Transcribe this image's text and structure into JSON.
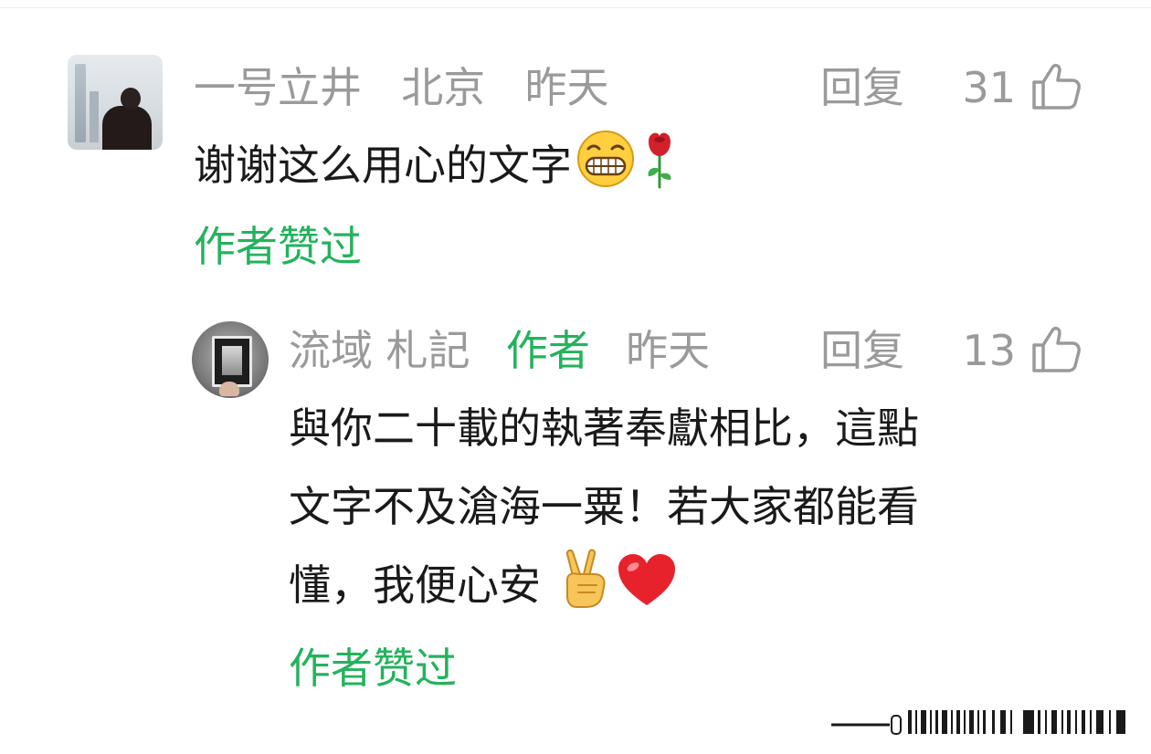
{
  "colors": {
    "meta_gray": "#9a9a9a",
    "text_black": "#1a1a1a",
    "accent_green": "#23b35c"
  },
  "comment": {
    "username": "一号立井",
    "location": "北京",
    "time": "昨天",
    "reply_label": "回复",
    "like_count": "31",
    "text": "谢谢这么用心的文字",
    "emojis": [
      "grinning-face",
      "rose"
    ],
    "author_liked": "作者赞过"
  },
  "reply": {
    "username": "流域 札記",
    "author_badge": "作者",
    "time": "昨天",
    "reply_label": "回复",
    "like_count": "13",
    "lines": [
      "與你二十載的執著奉獻相比，這點",
      "文字不及滄海一粟！若大家都能看",
      "懂，我便心安"
    ],
    "emojis": [
      "victory-hand",
      "red-heart"
    ],
    "author_liked": "作者赞过"
  }
}
